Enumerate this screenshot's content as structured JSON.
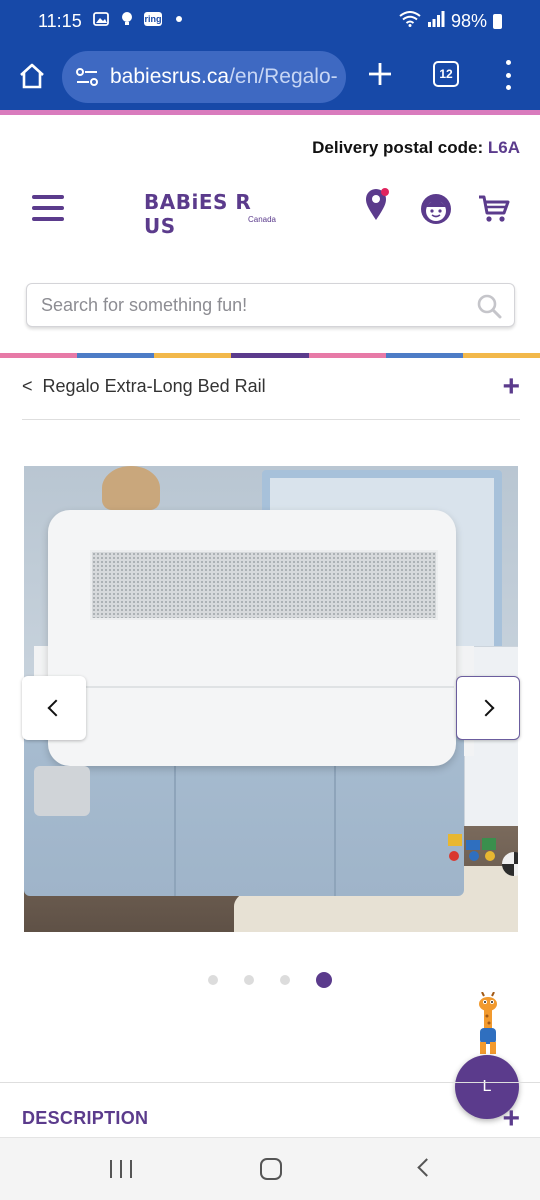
{
  "status_bar": {
    "time": "11:15",
    "notification_icons": [
      "gallery-icon",
      "bulb-icon",
      "ring-icon",
      "dot-icon"
    ],
    "ring_label": "ring",
    "battery": "98%"
  },
  "browser": {
    "url_host": "babiesrus.ca",
    "url_path": "/en/Regalo-",
    "tab_count": "12"
  },
  "header": {
    "delivery_label": "Delivery postal code:",
    "delivery_code": "L6A",
    "logo_text": "BABiES R US",
    "logo_sub": "Canada"
  },
  "search": {
    "placeholder": "Search for something fun!"
  },
  "colors": {
    "brand_purple": "#5b3b8c",
    "band": [
      "#e77aa7",
      "#4d7cc6",
      "#f2b84a",
      "#5b3b8c",
      "#e77aa7",
      "#4d7cc6",
      "#f2b84a"
    ]
  },
  "breadcrumb": {
    "back_symbol": "<",
    "label": "Regalo Extra-Long Bed Rail",
    "expand_symbol": "+"
  },
  "carousel": {
    "image_alt": "Regalo Extra-Long Bed Rail on a bed",
    "slide_count": 4,
    "active_slide": 4
  },
  "chat": {
    "label": "L"
  },
  "description": {
    "title": "DESCRIPTION",
    "expand_symbol": "+"
  }
}
